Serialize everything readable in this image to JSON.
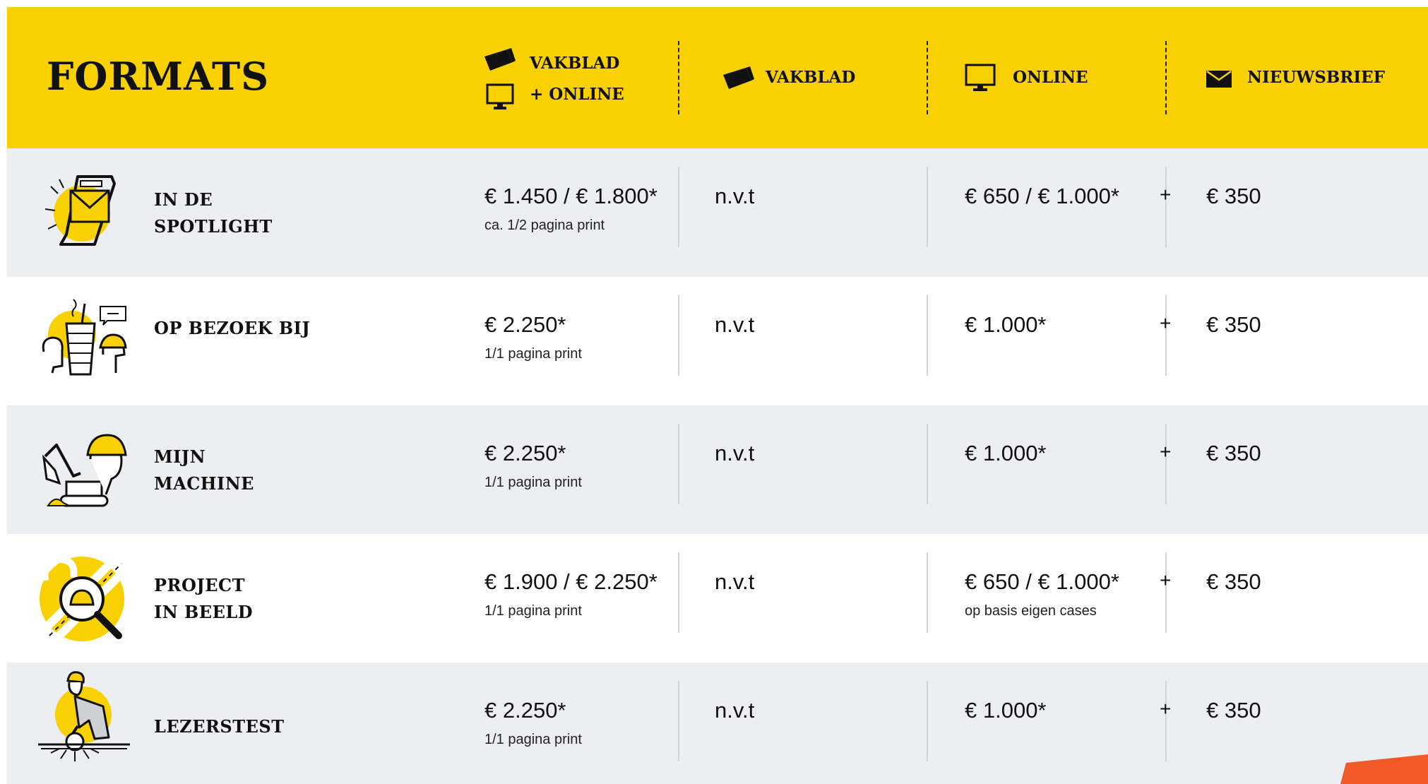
{
  "header": {
    "title": "FORMATS",
    "col_vakblad_online_line1": "VAKBLAD",
    "col_vakblad_online_line2": "+ ONLINE",
    "col_vakblad": "VAKBLAD",
    "col_online": "ONLINE",
    "col_nieuwsbrief": "NIEUWSBRIEF"
  },
  "rows": [
    {
      "name_line1": "IN DE",
      "name_line2": "SPOTLIGHT",
      "combo_price": "€ 1.450 / € 1.800*",
      "combo_sub": "ca. 1/2 pagina print",
      "vakblad": "n.v.t",
      "online_price": "€ 650 / € 1.000*",
      "online_sub": "",
      "plus": "+",
      "nieuwsbrief": "€ 350"
    },
    {
      "name_line1": "OP BEZOEK BIJ",
      "name_line2": "",
      "combo_price": "€ 2.250*",
      "combo_sub": "1/1 pagina print",
      "vakblad": "n.v.t",
      "online_price": "€ 1.000*",
      "online_sub": "",
      "plus": "+",
      "nieuwsbrief": "€ 350"
    },
    {
      "name_line1": "MIJN",
      "name_line2": "MACHINE",
      "combo_price": "€ 2.250*",
      "combo_sub": "1/1 pagina print",
      "vakblad": "n.v.t",
      "online_price": "€ 1.000*",
      "online_sub": "",
      "plus": "+",
      "nieuwsbrief": "€ 350"
    },
    {
      "name_line1": "PROJECT",
      "name_line2": "IN BEELD",
      "combo_price": "€ 1.900 / € 2.250*",
      "combo_sub": "1/1 pagina print",
      "vakblad": "n.v.t",
      "online_price": "€ 650 / € 1.000*",
      "online_sub": "op basis eigen cases",
      "plus": "+",
      "nieuwsbrief": "€ 350"
    },
    {
      "name_line1": "LEZERSTEST",
      "name_line2": "",
      "combo_price": "€ 2.250*",
      "combo_sub": "1/1 pagina print",
      "vakblad": "n.v.t",
      "online_price": "€ 1.000*",
      "online_sub": "",
      "plus": "+",
      "nieuwsbrief": "€ 350"
    }
  ],
  "colors": {
    "header_bg": "#f9d100",
    "row_gray": "#edeef1",
    "accent_yellow": "#f9d100",
    "orange": "#f05a28"
  },
  "icons": {
    "magazine": "magazine-icon",
    "monitor": "monitor-icon",
    "envelope": "envelope-icon"
  }
}
